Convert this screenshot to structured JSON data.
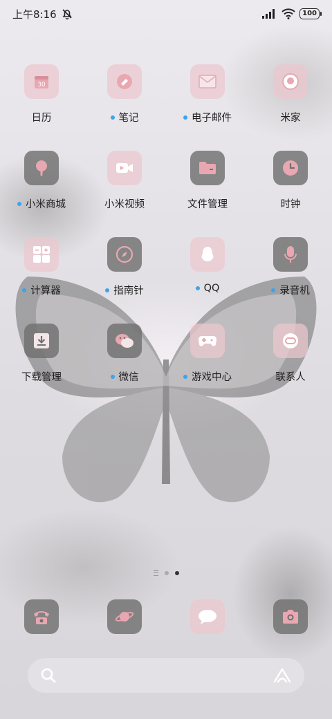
{
  "status_bar": {
    "time": "上午8:16",
    "battery": "100"
  },
  "apps": [
    {
      "id": "calendar",
      "label": "日历",
      "icon": "calendar-icon",
      "style": "pink",
      "dot": false,
      "badge": "30"
    },
    {
      "id": "notes",
      "label": "笔记",
      "icon": "notes-icon",
      "style": "pink",
      "dot": true
    },
    {
      "id": "email",
      "label": "电子邮件",
      "icon": "mail-icon",
      "style": "pink",
      "dot": true
    },
    {
      "id": "mijia",
      "label": "米家",
      "icon": "mijia-icon",
      "style": "pink",
      "dot": false
    },
    {
      "id": "mi-store",
      "label": "小米商城",
      "icon": "tree-icon",
      "style": "gray",
      "dot": true
    },
    {
      "id": "mi-video",
      "label": "小米视频",
      "icon": "video-icon",
      "style": "pink",
      "dot": false
    },
    {
      "id": "file-manager",
      "label": "文件管理",
      "icon": "folder-icon",
      "style": "gray",
      "dot": false
    },
    {
      "id": "clock",
      "label": "时钟",
      "icon": "clock-icon",
      "style": "gray",
      "dot": false
    },
    {
      "id": "calculator",
      "label": "计算器",
      "icon": "calculator-icon",
      "style": "pink",
      "dot": true
    },
    {
      "id": "compass",
      "label": "指南针",
      "icon": "compass-icon",
      "style": "gray",
      "dot": true
    },
    {
      "id": "qq",
      "label": "QQ",
      "icon": "penguin-icon",
      "style": "pink",
      "dot": true
    },
    {
      "id": "recorder",
      "label": "录音机",
      "icon": "microphone-icon",
      "style": "gray",
      "dot": true
    },
    {
      "id": "downloads",
      "label": "下载管理",
      "icon": "download-icon",
      "style": "gray",
      "dot": false
    },
    {
      "id": "wechat",
      "label": "微信",
      "icon": "wechat-icon",
      "style": "gray",
      "dot": true
    },
    {
      "id": "game-center",
      "label": "游戏中心",
      "icon": "gamepad-icon",
      "style": "pink",
      "dot": true
    },
    {
      "id": "contacts",
      "label": "联系人",
      "icon": "contacts-icon",
      "style": "pink",
      "dot": false
    }
  ],
  "dock": [
    {
      "id": "phone",
      "icon": "phone-icon",
      "style": "gray"
    },
    {
      "id": "browser",
      "icon": "planet-icon",
      "style": "gray"
    },
    {
      "id": "messages",
      "icon": "message-icon",
      "style": "pink"
    },
    {
      "id": "camera",
      "icon": "camera-icon",
      "style": "gray"
    }
  ],
  "page_indicator": {
    "pages": 3,
    "active": 2
  },
  "colors": {
    "pink_icon_bg": "#ecc8ce",
    "gray_icon_bg": "#707070",
    "glyph_pink": "#e9a7b1",
    "notification_dot": "#3aa4ec"
  }
}
